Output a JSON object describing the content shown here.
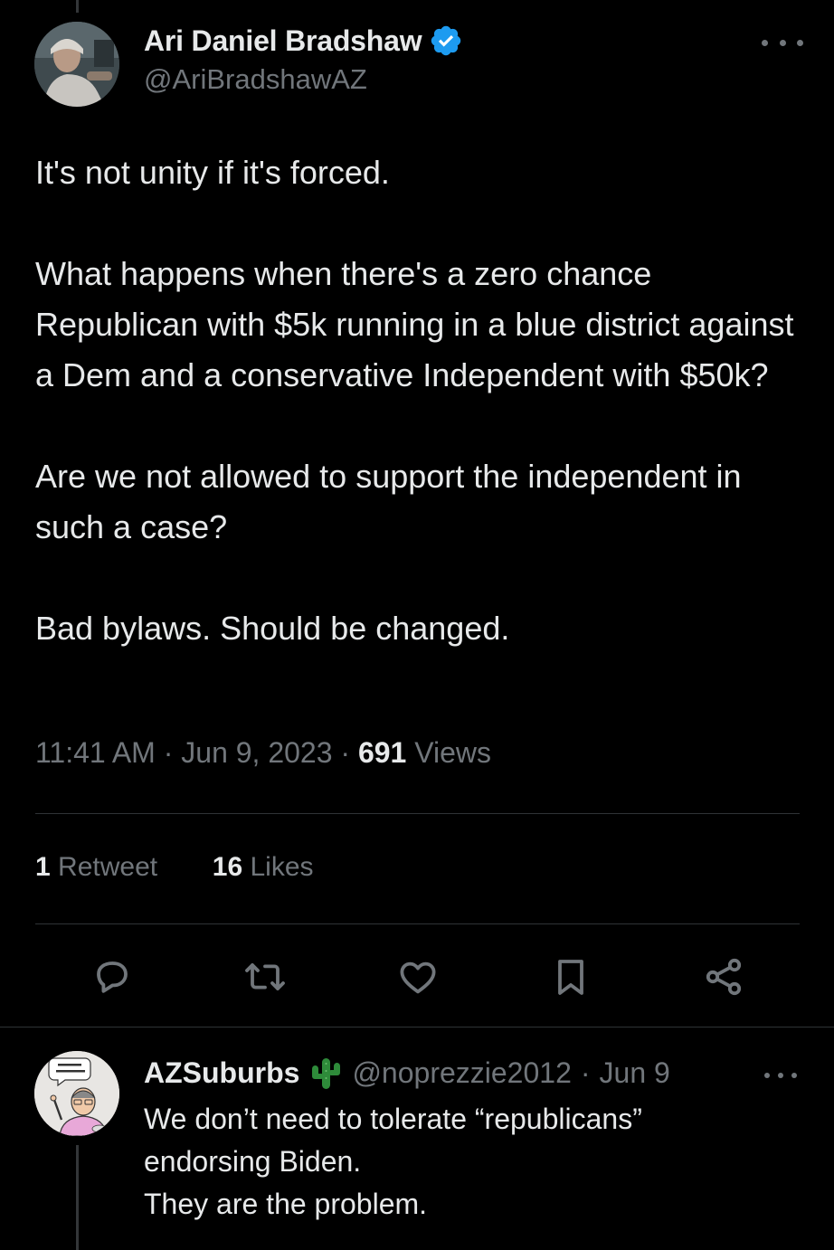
{
  "tweet": {
    "author_name": "Ari Daniel Bradshaw",
    "author_handle": "@AriBradshawAZ",
    "verified": true,
    "paragraphs": [
      "It's not unity if it's forced.",
      "What happens when there's a zero chance Republican with $5k running in a blue district against a Dem and a conservative Independent with $50k?",
      "Are we not allowed to support the independent in such a case?",
      "Bad bylaws. Should be changed."
    ],
    "time": "11:41 AM",
    "date": "Jun 9, 2023",
    "separator": "·",
    "views_count": "691",
    "views_label": "Views",
    "retweets_count": "1",
    "retweets_label": "Retweet",
    "likes_count": "16",
    "likes_label": "Likes"
  },
  "actions": [
    "reply-icon",
    "retweet-icon",
    "like-icon",
    "bookmark-icon",
    "share-icon"
  ],
  "reply": {
    "author_name": "AZSuburbs",
    "author_handle": "@noprezzie2012",
    "separator": "·",
    "date": "Jun 9",
    "lines": [
      "We don’t need to tolerate “republicans”",
      "endorsing Biden.",
      "They are the problem."
    ]
  },
  "colors": {
    "background": "#000000",
    "text_primary": "#e7e9ea",
    "text_secondary": "#71767b",
    "verified_blue": "#1d9bf0",
    "divider": "#2f3336",
    "cactus_green": "#2e8b3a"
  }
}
